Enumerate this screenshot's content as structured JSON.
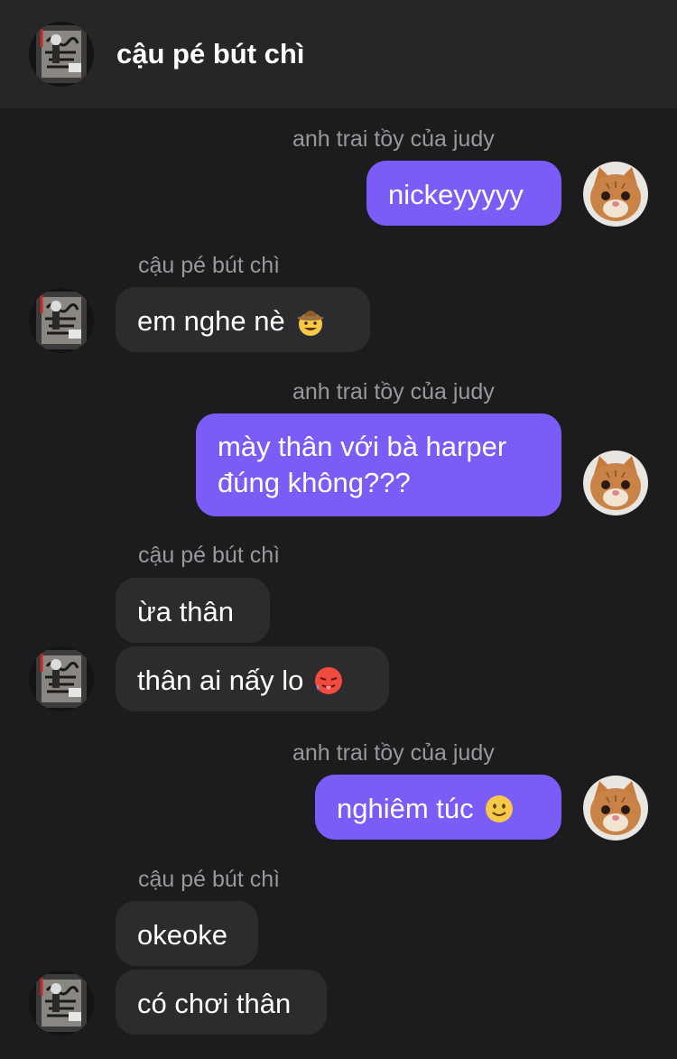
{
  "header": {
    "title": "cậu pé bút chì"
  },
  "messages": [
    {
      "sender": "anh trai tồy của judy",
      "text": "nickeyyyyy"
    },
    {
      "sender": "cậu pé bút chì",
      "text": "em nghe nè",
      "emoji": "cowboy-hat-face"
    },
    {
      "sender": "anh trai tồy của judy",
      "line1": "mày thân với bà harper",
      "line2": "đúng không???"
    },
    {
      "sender": "cậu pé bút chì",
      "text": "ừa thân"
    },
    {
      "text": "thân ai nấy lo",
      "emoji": "hot-face"
    },
    {
      "sender": "anh trai tồy của judy",
      "text": "nghiêm túc",
      "emoji": "slightly-smiling-face"
    },
    {
      "sender": "cậu pé bút chì",
      "text": "okeoke"
    },
    {
      "text": "có chơi thân"
    }
  ],
  "colors": {
    "background": "#1c1c1e",
    "header": "#262628",
    "outgoing_bubble": "#7b5cf6",
    "incoming_bubble": "#2c2c2e",
    "sender_name": "#98989e"
  },
  "icons": {
    "contact_avatar": "graffiti-photo-avatar",
    "self_avatar": "cat-photo-avatar"
  }
}
